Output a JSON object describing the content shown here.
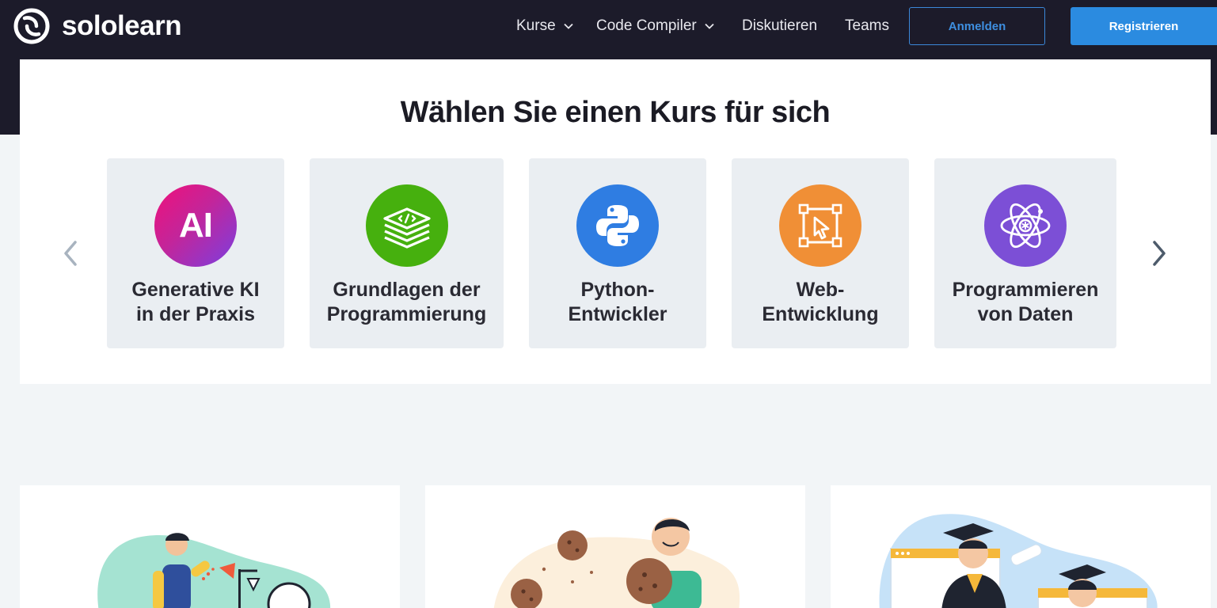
{
  "brand": {
    "name": "sololearn"
  },
  "nav": {
    "items": [
      {
        "label": "Kurse",
        "has_dropdown": true
      },
      {
        "label": "Code Compiler",
        "has_dropdown": true
      },
      {
        "label": "Diskutieren",
        "has_dropdown": false
      },
      {
        "label": "Teams",
        "has_dropdown": false
      }
    ],
    "login_label": "Anmelden",
    "register_label": "Registrieren"
  },
  "courses_section": {
    "title": "Wählen Sie einen Kurs für sich",
    "cards": [
      {
        "line1": "Generative KI",
        "line2": "in der Praxis",
        "icon": "ai-icon",
        "icon_text": "AI",
        "color": "#d6187a"
      },
      {
        "line1": "Grundlagen der",
        "line2": "Programmierung",
        "icon": "code-layers-icon",
        "color": "#46b00e"
      },
      {
        "line1": "Python-",
        "line2": "Entwickler",
        "icon": "python-icon",
        "color": "#2f7de2"
      },
      {
        "line1": "Web-",
        "line2": "Entwicklung",
        "icon": "cursor-select-icon",
        "color": "#f08f36"
      },
      {
        "line1": "Programmieren",
        "line2": "von Daten",
        "icon": "atom-icon",
        "color": "#7c4fd6"
      }
    ]
  },
  "colors": {
    "header_bg": "#1c1b2a",
    "page_bg": "#f2f5f7",
    "accent_blue": "#2b8be0"
  }
}
